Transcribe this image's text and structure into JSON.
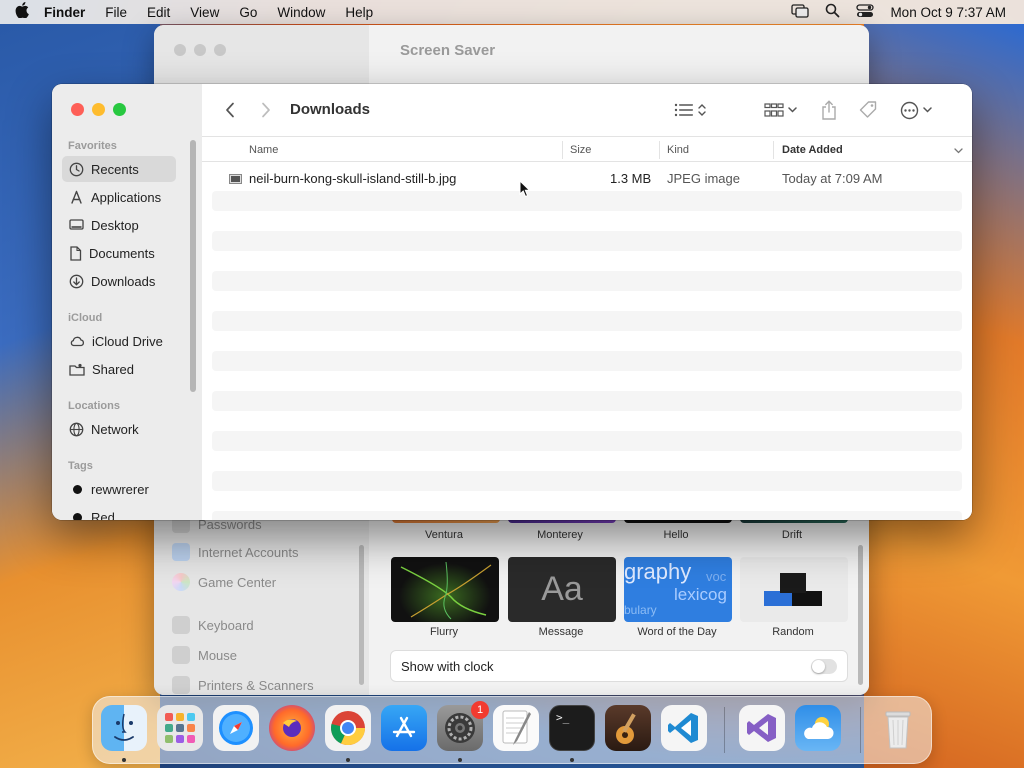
{
  "menubar": {
    "app_name": "Finder",
    "menus": [
      "File",
      "Edit",
      "View",
      "Go",
      "Window",
      "Help"
    ],
    "clock": "Mon Oct 9  7:37 AM"
  },
  "settings_window": {
    "title": "Screen Saver",
    "sidebar_items": [
      "Passwords",
      "Internet Accounts",
      "Game Center",
      "Keyboard",
      "Mouse",
      "Printers & Scanners"
    ],
    "screensavers_top": [
      "Ventura",
      "Monterey",
      "Hello",
      "Drift"
    ],
    "screensavers": [
      "Flurry",
      "Message",
      "Word of the Day",
      "Random"
    ],
    "message_thumb_text": "Aa",
    "word_thumb_text_1": "graphy",
    "word_thumb_text_2": "lexicog",
    "word_thumb_text_3": "bulary",
    "word_thumb_text_4": "voc",
    "show_with_clock": "Show with clock"
  },
  "finder": {
    "title": "Downloads",
    "sidebar": {
      "favorites_label": "Favorites",
      "favorites": [
        "Recents",
        "Applications",
        "Desktop",
        "Documents",
        "Downloads"
      ],
      "icloud_label": "iCloud",
      "icloud": [
        "iCloud Drive",
        "Shared"
      ],
      "locations_label": "Locations",
      "locations": [
        "Network"
      ],
      "tags_label": "Tags",
      "tags": [
        "rewwrerer",
        "Red"
      ]
    },
    "columns": {
      "name": "Name",
      "size": "Size",
      "kind": "Kind",
      "date_added": "Date Added"
    },
    "files": [
      {
        "name": "neil-burn-kong-skull-island-still-b.jpg",
        "size": "1.3 MB",
        "kind": "JPEG image",
        "date_added": "Today at 7:09 AM"
      }
    ]
  },
  "dock": {
    "apps": [
      "Finder",
      "Launchpad",
      "Safari",
      "Firefox",
      "Chrome",
      "App Store",
      "System Settings",
      "TextEdit",
      "Terminal",
      "GarageBand",
      "Visual Studio Code",
      "Visual Studio",
      "Weather",
      "Trash"
    ],
    "settings_badge": "1",
    "terminal_prompt": ">_"
  },
  "colors": {
    "close": "#fe5f57",
    "minimize": "#febc2e",
    "maximize": "#28c840",
    "tag_red": "#ff3b30"
  }
}
